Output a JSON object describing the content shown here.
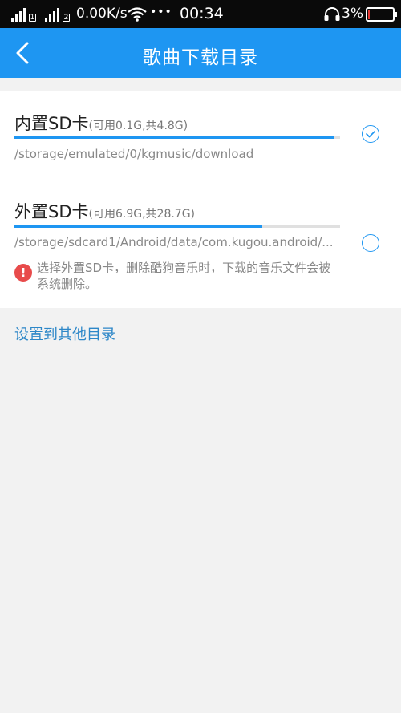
{
  "status_bar": {
    "sim1_label": "1",
    "sim2_label": "2",
    "net_speed": "0.00K/s",
    "dots": "•••",
    "time": "00:34",
    "battery_percent": "3%",
    "battery_level": 0.03
  },
  "nav": {
    "back_icon": "chevron-left-icon",
    "title": "歌曲下载目录"
  },
  "storage": [
    {
      "name": "内置SD卡",
      "detail": "(可用0.1G,共4.8G)",
      "used_fraction": 0.98,
      "path": "/storage/emulated/0/kgmusic/download",
      "selected": true
    },
    {
      "name": "外置SD卡",
      "detail": "(可用6.9G,共28.7G)",
      "used_fraction": 0.76,
      "path": "/storage/sdcard1/Android/data/com.kugou.android/...",
      "selected": false
    }
  ],
  "warning": {
    "icon": "!",
    "text": "选择外置SD卡，删除酷狗音乐时，下载的音乐文件会被系统删除。"
  },
  "other_dir_label": "设置到其他目录",
  "colors": {
    "accent": "#1e96f2",
    "warning": "#e84b4b",
    "link": "#2d87c8"
  }
}
